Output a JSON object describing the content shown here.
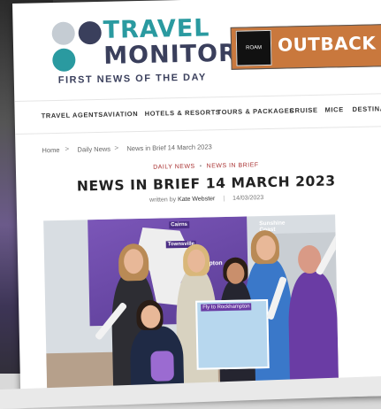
{
  "brand": {
    "name_line1": "TRAVEL",
    "name_line2": "MONITOR",
    "tagline": "FIRST NEWS OF THE DAY"
  },
  "ad": {
    "logo_text": "ROAM",
    "text": "OUTBACK CAM"
  },
  "nav": {
    "items": [
      "TRAVEL AGENTS",
      "AVIATION",
      "HOTELS & RESORTS",
      "TOURS & PACKAGES",
      "CRUISE",
      "MICE",
      "DESTINAT"
    ]
  },
  "breadcrumb": {
    "home": "Home",
    "sep": ">",
    "section": "Daily News",
    "current": "News in Brief 14 March 2023"
  },
  "article": {
    "category1": "DAILY NEWS",
    "category_sep": "•",
    "category2": "NEWS IN BRIEF",
    "title": "NEWS IN BRIEF 14 MARCH 2023",
    "byline_prefix": "written by",
    "author": "Kate Webster",
    "date": "14/03/2023"
  },
  "photo": {
    "banner_cities": [
      "Cairns",
      "Townsville",
      "mpton",
      "Sunshine Coast"
    ],
    "poster_text": "Fly to Rockhampton"
  },
  "colors": {
    "teal": "#2a9aa0",
    "navy": "#3a3f5c",
    "purple": "#6a3ca4",
    "category_red": "#a33"
  }
}
